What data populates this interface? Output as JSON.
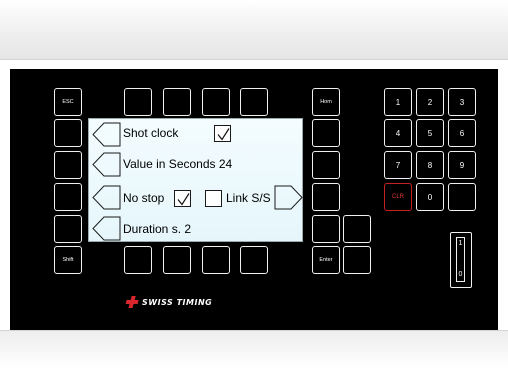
{
  "left_keys": {
    "esc": "ESC",
    "shift": "Shift"
  },
  "middle_keys": {
    "hom": "Hom",
    "enter": "Enter"
  },
  "lcd": {
    "line1": "Shot clock",
    "line2": "Value in Seconds 24",
    "line3_left": "No stop",
    "line3_right": "Link S/S",
    "line4": "Duration s. 2",
    "shot_clock_checked": true,
    "no_stop_checked": true,
    "link_ss_checked": false
  },
  "numpad": {
    "k1": "1",
    "k2": "2",
    "k3": "3",
    "k4": "4",
    "k5": "5",
    "k6": "6",
    "k7": "7",
    "k8": "8",
    "k9": "9",
    "clr": "CLR",
    "k0": "0"
  },
  "toggle": {
    "top": "1",
    "bottom": "0"
  },
  "brand": {
    "name": "SWISS TIMING",
    "accent": "#d9272e"
  }
}
